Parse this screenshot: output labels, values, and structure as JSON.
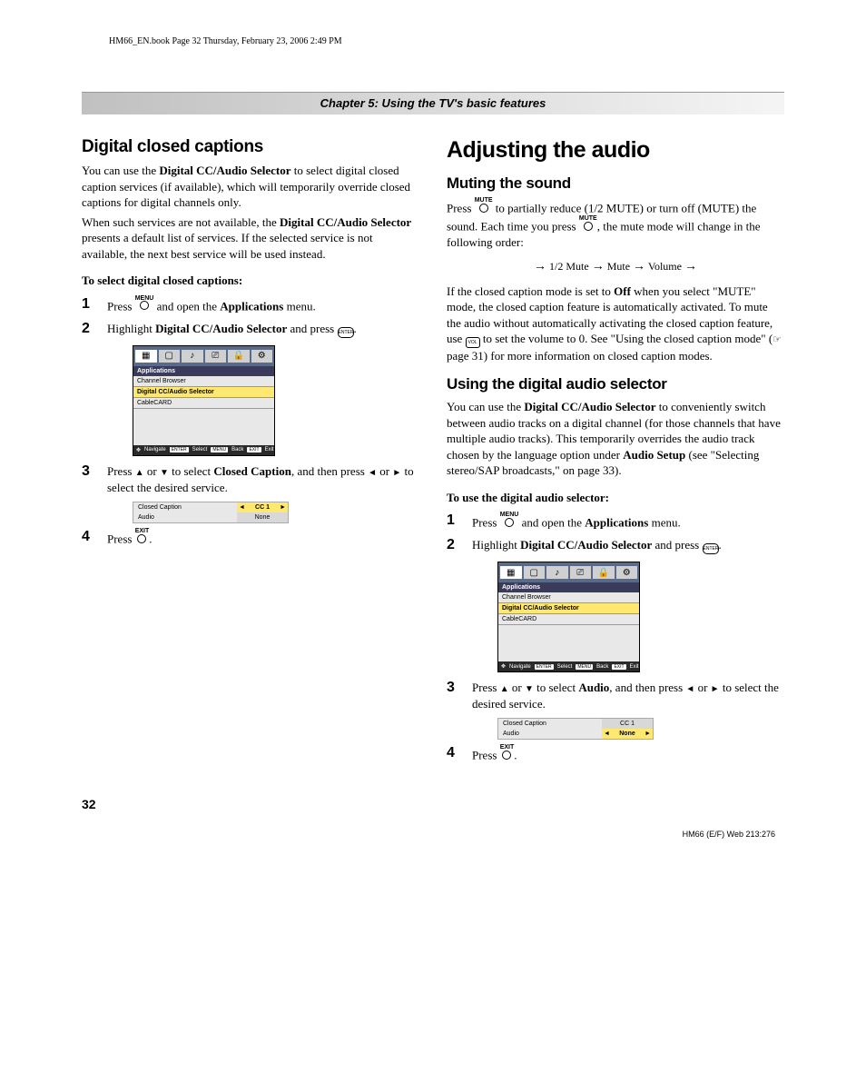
{
  "header": {
    "meta": "HM66_EN.book  Page 32  Thursday, February 23, 2006  2:49 PM",
    "chapter": "Chapter 5: Using the TV's basic features"
  },
  "left": {
    "h2": "Digital closed captions",
    "p1a": "You can use the ",
    "p1b": "Digital CC/Audio Selector",
    "p1c": " to select digital closed caption services (if available), which will temporarily override closed captions for digital channels only.",
    "p2a": "When such services are not available, the ",
    "p2b": "Digital CC/Audio Selector",
    "p2c": " presents a default list of services. If the selected service is not available, the next best service will be used instead.",
    "sub1": "To select digital closed captions:",
    "s1a": "Press ",
    "s1b": " and open the ",
    "s1c": "Applications",
    "s1d": " menu.",
    "s2a": "Highlight ",
    "s2b": "Digital CC/Audio Selector",
    "s2c": " and press ",
    "menu": {
      "title": "Applications",
      "i1": "Channel Browser",
      "i2": "Digital CC/Audio Selector",
      "i3": "CableCARD",
      "nav": "Navigate",
      "sel": "Select",
      "back": "Back",
      "exit": "Exit"
    },
    "s3a": "Press ",
    "s3b": " or ",
    "s3c": " to select ",
    "s3d": "Closed Caption",
    "s3e": ", and then press ",
    "s3f": " or ",
    "s3g": " to select the desired service.",
    "opt": {
      "r1l": "Closed Caption",
      "r1v": "CC 1",
      "r2l": "Audio",
      "r2v": "None"
    },
    "s4a": "Press ",
    "s4b": "."
  },
  "right": {
    "h1": "Adjusting the audio",
    "h3a": "Muting the sound",
    "p1a": "Press ",
    "p1b": " to partially reduce (1/2 MUTE) or turn off (MUTE) the sound. Each time you press ",
    "p1c": ", the mute mode will change in the following order:",
    "flow": {
      "a": "1/2 Mute",
      "b": "Mute",
      "c": "Volume"
    },
    "p2a": "If the closed caption mode is set to ",
    "p2b": "Off",
    "p2c": " when you select \"MUTE\" mode, the closed caption feature is automatically activated. To mute the audio without automatically activating the closed caption feature, use ",
    "p2d": " to set the volume to 0. See \"Using the closed caption mode\" (",
    "p2e": " page 31) for more information on closed caption modes.",
    "h3b": "Using the digital audio selector",
    "p3a": "You can use the ",
    "p3b": "Digital CC/Audio Selector",
    "p3c": " to conveniently switch between audio tracks on a digital channel (for those channels that have multiple audio tracks). This temporarily overrides the audio track chosen by the language option under ",
    "p3d": "Audio Setup",
    "p3e": " (see \"Selecting stereo/SAP broadcasts,\" on page 33).",
    "sub1": "To use the digital audio selector:",
    "s1a": "Press ",
    "s1b": " and open the ",
    "s1c": "Applications",
    "s1d": " menu.",
    "s2a": "Highlight ",
    "s2b": "Digital CC/Audio Selector",
    "s2c": " and press ",
    "s3a": "Press ",
    "s3b": " or ",
    "s3c": " to select ",
    "s3d": "Audio",
    "s3e": ", and then press ",
    "s3f": " or ",
    "s3g": " to select the desired service.",
    "opt": {
      "r1l": "Closed Caption",
      "r1v": "CC 1",
      "r2l": "Audio",
      "r2v": "None"
    },
    "s4a": "Press ",
    "s4b": "."
  },
  "labels": {
    "menu": "MENU",
    "exit": "EXIT",
    "mute": "MUTE",
    "vol": "VOL",
    "enter": "ENTER"
  },
  "footer": {
    "page": "32",
    "code": "HM66 (E/F) Web 213:276"
  }
}
